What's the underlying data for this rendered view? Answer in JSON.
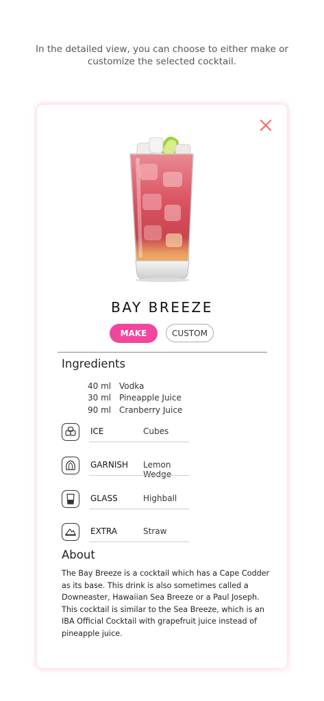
{
  "caption": "In the detailed view, you can choose to either make or customize the selected cocktail.",
  "cocktail": {
    "name": "BAY BREEZE"
  },
  "actions": {
    "make_label": "MAKE",
    "custom_label": "CUSTOM"
  },
  "ingredients": {
    "heading": "Ingredients",
    "items": [
      {
        "amount": "40 ml",
        "name": "Vodka"
      },
      {
        "amount": "30 ml",
        "name": "Pineapple Juice"
      },
      {
        "amount": "90 ml",
        "name": "Cranberry Juice"
      }
    ]
  },
  "properties": [
    {
      "icon": "ice-icon",
      "label": "ICE",
      "value": "Cubes"
    },
    {
      "icon": "garnish-icon",
      "label": "GARNISH",
      "value": "Lemon Wedge"
    },
    {
      "icon": "glass-icon",
      "label": "GLASS",
      "value": "Highball"
    },
    {
      "icon": "extra-icon",
      "label": "EXTRA",
      "value": "Straw"
    }
  ],
  "about": {
    "heading": "About",
    "text": "The Bay Breeze is a cocktail which has a Cape Codder as its base. This drink is also sometimes called a Downeaster, Hawaiian Sea Breeze or a Paul Joseph. This cocktail is similar to the Sea Breeze, which is an IBA Official Cocktail with grapefruit juice instead of pineapple juice."
  },
  "colors": {
    "accent": "#f2459e",
    "close": "#f06a6a",
    "card_glow": "#ffb0d6"
  }
}
